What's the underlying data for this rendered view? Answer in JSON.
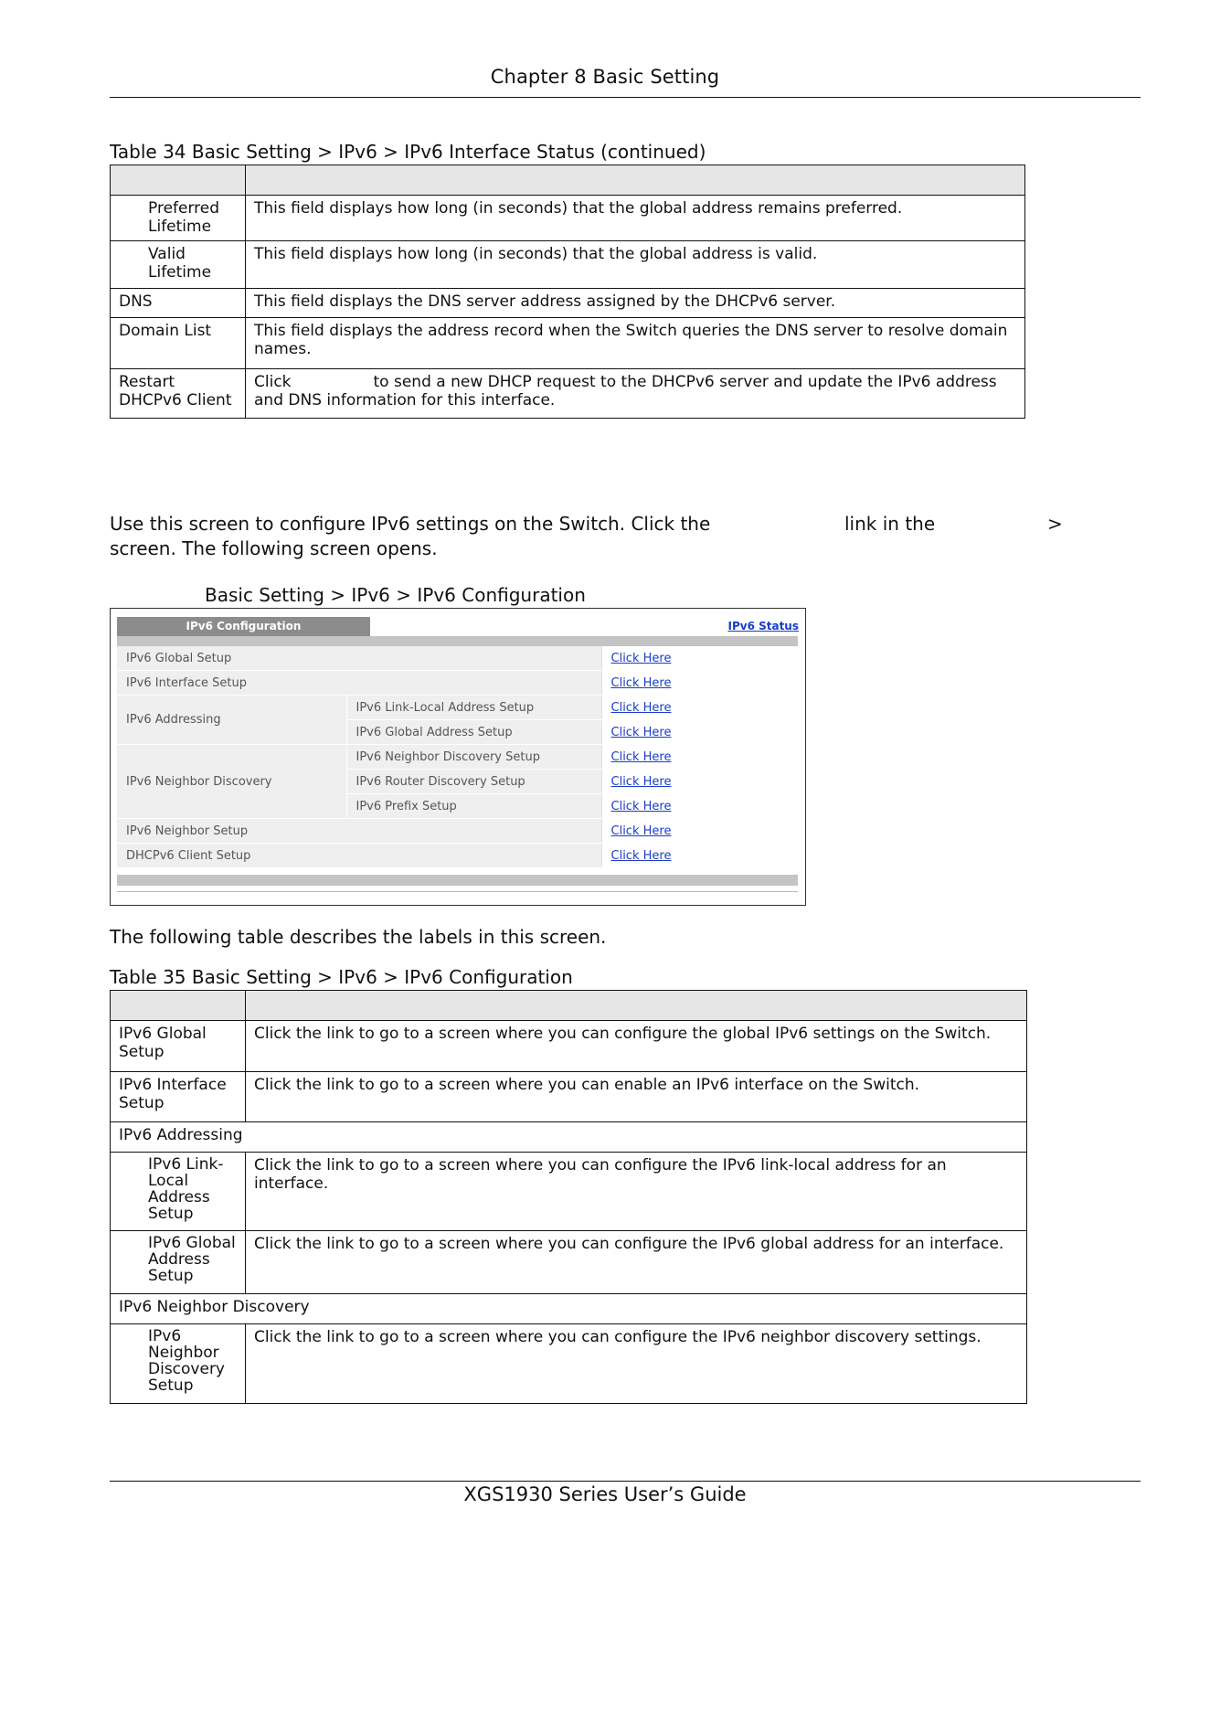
{
  "header": {
    "chapter": "Chapter 8 Basic Setting"
  },
  "table34": {
    "caption": "Table 34   Basic Setting > IPv6 > IPv6 Interface Status (continued)",
    "rows": [
      {
        "label": "Preferred Lifetime",
        "desc": "This field displays how long (in seconds) that the global address remains preferred."
      },
      {
        "label": "Valid Lifetime",
        "desc": "This field displays how long (in seconds) that the global address is valid."
      },
      {
        "label": "DNS",
        "desc": "This field displays the DNS server address assigned by the DHCPv6 server."
      },
      {
        "label": "Domain List",
        "desc": "This field displays the address record when the Switch queries the DNS server to resolve domain names."
      },
      {
        "label": "Restart DHCPv6 Client",
        "desc_start": "Click",
        "desc_rest": "to send a new DHCP request to the DHCPv6 server and update the IPv6 address and DNS information for this interface."
      }
    ]
  },
  "intro": {
    "line1_start": "Use this screen to configure IPv6 settings on the Switch. Click the",
    "line1_mid": "link in the",
    "line1_end": ">",
    "line2": "screen. The following screen opens."
  },
  "figure": {
    "caption": "Basic Setting > IPv6 > IPv6 Configuration"
  },
  "screen": {
    "tab_title": "IPv6 Configuration",
    "status_link": "IPv6 Status",
    "link_text": "Click Here",
    "rows": {
      "global_setup": "IPv6 Global Setup",
      "interface_setup": "IPv6 Interface Setup",
      "addressing": "IPv6 Addressing",
      "link_local": "IPv6 Link-Local Address Setup",
      "global_address": "IPv6 Global Address Setup",
      "neighbor_discovery": "IPv6 Neighbor Discovery",
      "nd_setup": "IPv6 Neighbor Discovery Setup",
      "router_discovery": "IPv6 Router Discovery Setup",
      "prefix_setup": "IPv6 Prefix Setup",
      "neighbor_setup": "IPv6 Neighbor Setup",
      "dhcpv6_client": "DHCPv6 Client Setup"
    }
  },
  "between_text": "The following table describes the labels in this screen.",
  "table35": {
    "caption": "Table 35   Basic Setting > IPv6 > IPv6 Configuration",
    "global_label": "IPv6 Global Setup",
    "global_desc": "Click the link to go to a screen where you can configure the global IPv6 settings on the Switch.",
    "interface_label": "IPv6 Interface Setup",
    "interface_desc": "Click the link to go to a screen where you can enable an IPv6 interface on the Switch.",
    "addressing_section": "IPv6 Addressing",
    "linklocal_label": "IPv6 Link-Local Address Setup",
    "linklocal_desc": "Click the link to go to a screen where you can configure the IPv6 link-local address for an interface.",
    "globaladdr_label": "IPv6 Global Address Setup",
    "globaladdr_desc": "Click the link to go to a screen where you can configure the IPv6 global address for an interface.",
    "nd_section": "IPv6 Neighbor Discovery",
    "nd_label": "IPv6 Neighbor Discovery Setup",
    "nd_desc": "Click the link to go to a screen where you can configure the IPv6 neighbor discovery settings."
  },
  "footer": {
    "guide": "XGS1930 Series User’s Guide"
  }
}
